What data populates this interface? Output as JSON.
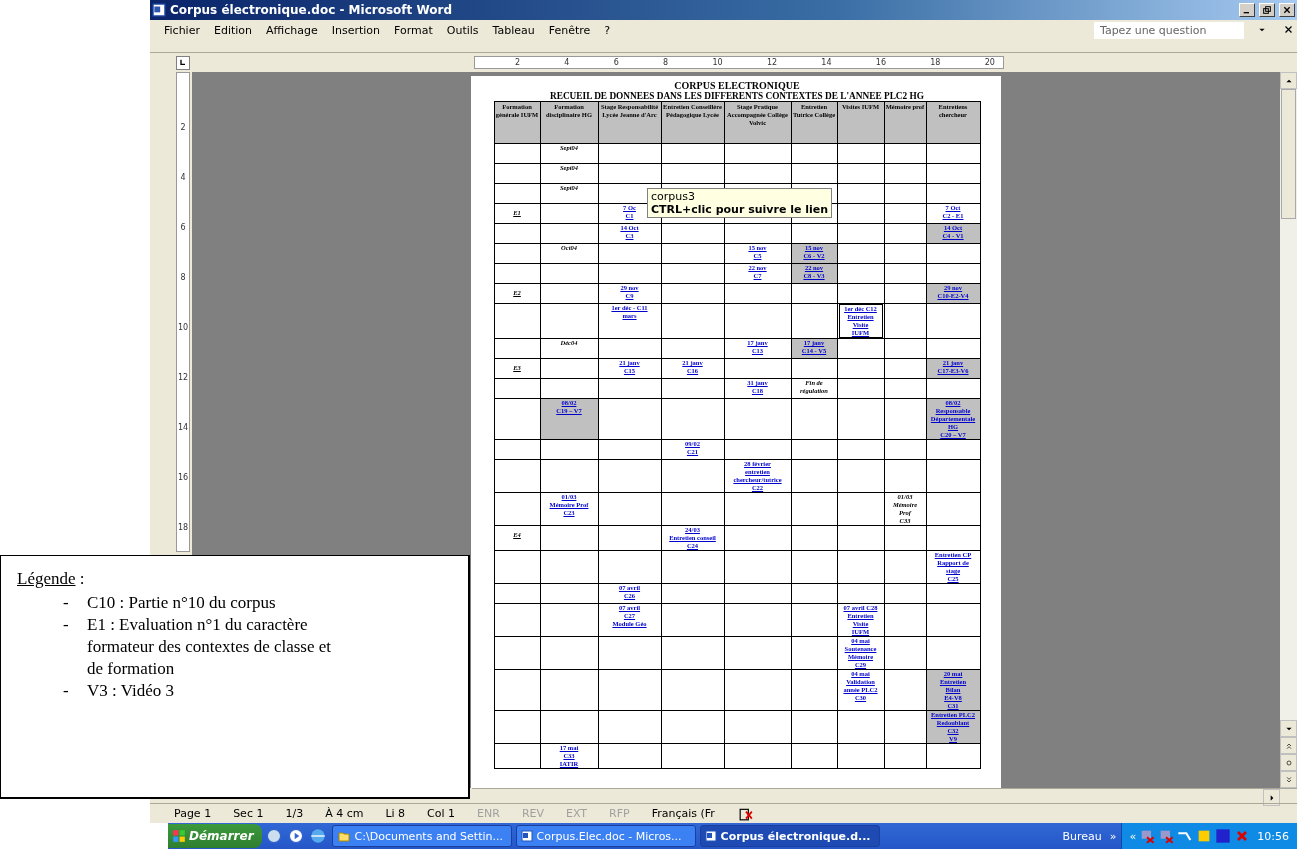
{
  "window": {
    "title": "Corpus électronique.doc - Microsoft Word"
  },
  "menu_bar": {
    "items": [
      "Fichier",
      "Edition",
      "Affichage",
      "Insertion",
      "Format",
      "Outils",
      "Tableau",
      "Fenêtre",
      "?"
    ],
    "question_placeholder": "Tapez une question"
  },
  "rulers": {
    "horizontal": [
      "2",
      "4",
      "6",
      "8",
      "10",
      "12",
      "14",
      "16",
      "18",
      "20"
    ],
    "vertical": [
      "2",
      "4",
      "6",
      "8",
      "10",
      "12",
      "14",
      "16",
      "18"
    ]
  },
  "document": {
    "title": "CORPUS ELECTRONIQUE",
    "subtitle": "RECUEIL DE DONNEES DANS LES DIFFERENTS CONTEXTES DE L'ANNEE PLC2 HG",
    "table": {
      "columns": [
        "Formation générale IUFM",
        "Formation disciplinaire HG",
        "Stage Responsabilité Lycée Jeanne d'Arc",
        "Entretien Conseillère Pédagogique Lycée",
        "Stage Pratique Accompagnée Collège Volvic",
        "Entretien Tutrice Collège",
        "Visites IUFM",
        "Mémoire prof",
        "Entretiens chercheur"
      ],
      "rows": [
        {
          "cells": [
            null,
            {
              "lines": [
                "Sept04"
              ],
              "kind": "note",
              "shaded": false
            },
            null,
            null,
            null,
            null,
            null,
            null,
            null
          ]
        },
        {
          "cells": [
            null,
            {
              "lines": [
                "Sept04"
              ],
              "kind": "note",
              "shaded": false
            },
            null,
            null,
            null,
            null,
            null,
            null,
            null
          ]
        },
        {
          "cells": [
            null,
            {
              "lines": [
                "Sept04"
              ],
              "kind": "note",
              "shaded": false
            },
            null,
            null,
            null,
            null,
            null,
            null,
            null
          ]
        },
        {
          "cells": [
            {
              "lines": [
                "E1"
              ],
              "kind": "mark",
              "shaded": false
            },
            null,
            {
              "lines": [
                "7 Oc",
                "C1"
              ],
              "kind": "link",
              "shaded": false
            },
            null,
            null,
            null,
            null,
            null,
            {
              "lines": [
                "7 Oct",
                "C2 - E1"
              ],
              "kind": "link",
              "shaded": false
            }
          ]
        },
        {
          "cells": [
            null,
            null,
            {
              "lines": [
                "14 Oct",
                "C3"
              ],
              "kind": "link",
              "shaded": false
            },
            null,
            null,
            null,
            null,
            null,
            {
              "lines": [
                "14 Oct",
                "C4 - V1"
              ],
              "kind": "link",
              "shaded": true
            }
          ]
        },
        {
          "cells": [
            null,
            {
              "lines": [
                "Oct04"
              ],
              "kind": "note",
              "shaded": false
            },
            null,
            null,
            {
              "lines": [
                "15 nov",
                "C5"
              ],
              "kind": "link",
              "shaded": false
            },
            {
              "lines": [
                "15 nov",
                "C6 - V2"
              ],
              "kind": "link",
              "shaded": true
            },
            null,
            null,
            null
          ]
        },
        {
          "cells": [
            null,
            null,
            null,
            null,
            {
              "lines": [
                "22 nov",
                "C7"
              ],
              "kind": "link",
              "shaded": false
            },
            {
              "lines": [
                "22 nov",
                "C8 - V3"
              ],
              "kind": "link",
              "shaded": true
            },
            null,
            null,
            null
          ]
        },
        {
          "cells": [
            {
              "lines": [
                "E2"
              ],
              "kind": "mark",
              "shaded": false
            },
            null,
            {
              "lines": [
                "29 nov",
                "C9"
              ],
              "kind": "link",
              "shaded": false
            },
            null,
            null,
            null,
            null,
            null,
            {
              "lines": [
                "29 nov",
                "C10-E2-V4"
              ],
              "kind": "link",
              "shaded": true
            }
          ]
        },
        {
          "cells": [
            null,
            null,
            {
              "lines": [
                "1er déc - C11",
                "mars"
              ],
              "kind": "link",
              "shaded": false
            },
            null,
            null,
            null,
            {
              "lines": [
                "1er déc C12",
                "Entretien",
                "Visite",
                "IUFM"
              ],
              "kind": "boxed",
              "shaded": false
            },
            null,
            null
          ]
        },
        {
          "cells": [
            null,
            {
              "lines": [
                "Déc04"
              ],
              "kind": "note",
              "shaded": false
            },
            null,
            null,
            {
              "lines": [
                "17 janv",
                "C13"
              ],
              "kind": "link",
              "shaded": false
            },
            {
              "lines": [
                "17 janv",
                "C14 - V5"
              ],
              "kind": "link",
              "shaded": true
            },
            null,
            null,
            null
          ]
        },
        {
          "cells": [
            {
              "lines": [
                "E3"
              ],
              "kind": "mark",
              "shaded": false
            },
            null,
            {
              "lines": [
                "21 janv",
                "C15"
              ],
              "kind": "link",
              "shaded": false
            },
            {
              "lines": [
                "21 janv",
                "C16"
              ],
              "kind": "link",
              "shaded": false
            },
            null,
            null,
            null,
            null,
            {
              "lines": [
                "21 janv",
                "C17-E3-V6"
              ],
              "kind": "link",
              "shaded": true
            }
          ]
        },
        {
          "cells": [
            null,
            null,
            null,
            null,
            {
              "lines": [
                "31 janv",
                "C18"
              ],
              "kind": "link",
              "shaded": false
            },
            {
              "lines": [
                "Fin de",
                "régulation"
              ],
              "kind": "note",
              "shaded": false
            },
            null,
            null,
            null
          ]
        },
        {
          "cells": [
            null,
            {
              "lines": [
                "08/02",
                "C19 – V7"
              ],
              "kind": "link",
              "shaded": true
            },
            null,
            null,
            null,
            null,
            null,
            null,
            {
              "lines": [
                "08/02",
                "Responsable",
                "Départementale",
                "HG",
                "C20 – V7"
              ],
              "kind": "link",
              "shaded": true
            }
          ]
        },
        {
          "cells": [
            null,
            null,
            null,
            {
              "lines": [
                "09/02",
                "C21"
              ],
              "kind": "link",
              "shaded": false
            },
            null,
            null,
            null,
            null,
            null
          ]
        },
        {
          "cells": [
            null,
            null,
            null,
            null,
            {
              "lines": [
                "28 février",
                "entretien",
                "chercheur/tutrice",
                "C22"
              ],
              "kind": "link",
              "shaded": false
            },
            null,
            null,
            null,
            null
          ]
        },
        {
          "cells": [
            null,
            {
              "lines": [
                "01/03",
                "Mémoire Prof",
                "C23"
              ],
              "kind": "link",
              "shaded": false
            },
            null,
            null,
            null,
            null,
            null,
            {
              "lines": [
                "01/03",
                "Mémoire",
                "Prof",
                "C33"
              ],
              "kind": "note",
              "shaded": false
            },
            null
          ]
        },
        {
          "cells": [
            {
              "lines": [
                "E4"
              ],
              "kind": "mark",
              "shaded": false
            },
            null,
            null,
            {
              "lines": [
                "24/03",
                "Entretien conseil",
                "C24"
              ],
              "kind": "link",
              "shaded": false
            },
            null,
            null,
            null,
            null,
            null
          ]
        },
        {
          "cells": [
            null,
            null,
            null,
            null,
            null,
            null,
            null,
            null,
            {
              "lines": [
                "Entretien CP",
                "Rapport de",
                "stage",
                "C25"
              ],
              "kind": "link",
              "shaded": false
            }
          ]
        },
        {
          "cells": [
            null,
            null,
            {
              "lines": [
                "07 avril",
                "C26"
              ],
              "kind": "link",
              "shaded": false
            },
            null,
            null,
            null,
            null,
            null,
            null
          ]
        },
        {
          "cells": [
            null,
            null,
            {
              "lines": [
                "07 avril",
                "C27",
                "Module Géo"
              ],
              "kind": "link",
              "shaded": false
            },
            null,
            null,
            null,
            {
              "lines": [
                "07 avril C28",
                "Entretien",
                "Visite",
                "IUFM"
              ],
              "kind": "link",
              "shaded": false
            },
            null,
            null
          ]
        },
        {
          "cells": [
            null,
            null,
            null,
            null,
            null,
            null,
            {
              "lines": [
                "04 mai",
                "Soutenance",
                "Mémoire",
                "C29"
              ],
              "kind": "link",
              "shaded": false
            },
            null,
            null
          ]
        },
        {
          "cells": [
            null,
            null,
            null,
            null,
            null,
            null,
            {
              "lines": [
                "04 mai",
                "Validation",
                "année PLC2",
                "C30"
              ],
              "kind": "link",
              "shaded": false
            },
            null,
            {
              "lines": [
                "20 mai",
                "Entretien",
                "Bilan",
                "E4-V8",
                "C31"
              ],
              "kind": "link",
              "shaded": true
            }
          ]
        },
        {
          "cells": [
            null,
            null,
            null,
            null,
            null,
            null,
            null,
            null,
            {
              "lines": [
                "Entretien PLC2",
                "Redoublant",
                "C32",
                "V9"
              ],
              "kind": "link",
              "shaded": true
            }
          ]
        },
        {
          "cells": [
            null,
            {
              "lines": [
                "17 mai",
                "C33",
                "IATIR"
              ],
              "kind": "link",
              "shaded": false
            },
            null,
            null,
            null,
            null,
            null,
            null,
            null
          ]
        }
      ]
    }
  },
  "tooltip": {
    "title": "corpus3",
    "hint": "CTRL+clic pour suivre le lien"
  },
  "legend": {
    "heading": "Légende",
    "suffix": " :",
    "items": [
      {
        "marker": "-",
        "text": "C10 : Partie n°10 du corpus"
      },
      {
        "marker": "-",
        "text": "E1 : Evaluation n°1 du caractère formateur des contextes de classe et de formation"
      },
      {
        "marker": "-",
        "text": "V3 : Vidéo 3"
      }
    ]
  },
  "status_bar": {
    "items": [
      {
        "text": "Page 1",
        "disabled": false
      },
      {
        "text": "Sec 1",
        "disabled": false
      },
      {
        "text": "1/3",
        "disabled": false
      },
      {
        "text": "À 4 cm",
        "disabled": false
      },
      {
        "text": "Li 8",
        "disabled": false
      },
      {
        "text": "Col 1",
        "disabled": false
      },
      {
        "text": "ENR",
        "disabled": true
      },
      {
        "text": "REV",
        "disabled": true
      },
      {
        "text": "EXT",
        "disabled": true
      },
      {
        "text": "RFP",
        "disabled": true
      },
      {
        "text": "Français (Fr",
        "disabled": false
      }
    ]
  },
  "taskbar": {
    "start": "Démarrer",
    "tasks": [
      {
        "label": "C:\\Documents and Settin...",
        "kind": "folder",
        "selected": false
      },
      {
        "label": "Corpus.Elec.doc - Micros...",
        "kind": "word",
        "selected": false
      },
      {
        "label": "Corpus électronique.d...",
        "kind": "word",
        "selected": true
      }
    ],
    "toolbar": "Bureau",
    "expand": "»",
    "collapse": "«",
    "clock": "10:56"
  }
}
